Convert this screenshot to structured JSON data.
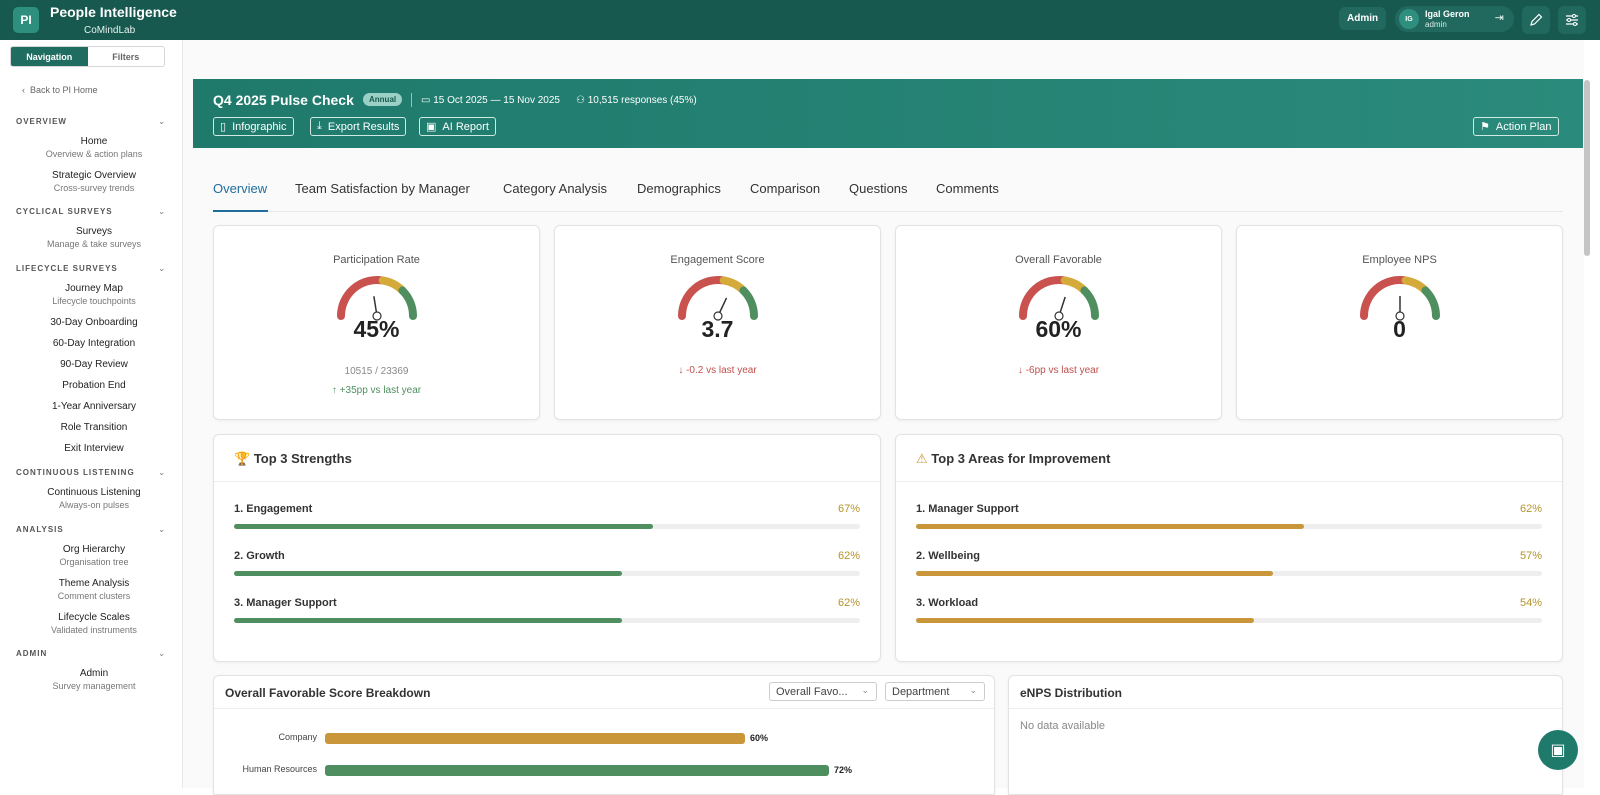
{
  "app": {
    "logo": "PI",
    "title": "People Intelligence",
    "org": "CoMindLab"
  },
  "topbar": {
    "admin_label": "Admin",
    "user_initials": "IG",
    "user_name": "Igal Geron",
    "user_role": "admin"
  },
  "sidebar": {
    "tabs": [
      "Navigation",
      "Filters"
    ],
    "back": "Back to PI Home",
    "sections": [
      {
        "title": "OVERVIEW",
        "items": [
          {
            "title": "Home",
            "sub": "Overview & action plans"
          },
          {
            "title": "Strategic Overview",
            "sub": "Cross-survey trends"
          }
        ]
      },
      {
        "title": "CYCLICAL SURVEYS",
        "items": [
          {
            "title": "Surveys",
            "sub": "Manage & take surveys"
          }
        ]
      },
      {
        "title": "LIFECYCLE SURVEYS",
        "items": [
          {
            "title": "Journey Map",
            "sub": "Lifecycle touchpoints"
          },
          {
            "title": "30-Day Onboarding",
            "sub": ""
          },
          {
            "title": "60-Day Integration",
            "sub": ""
          },
          {
            "title": "90-Day Review",
            "sub": ""
          },
          {
            "title": "Probation End",
            "sub": ""
          },
          {
            "title": "1-Year Anniversary",
            "sub": ""
          },
          {
            "title": "Role Transition",
            "sub": ""
          },
          {
            "title": "Exit Interview",
            "sub": ""
          }
        ]
      },
      {
        "title": "CONTINUOUS LISTENING",
        "items": [
          {
            "title": "Continuous Listening",
            "sub": "Always-on pulses"
          }
        ]
      },
      {
        "title": "ANALYSIS",
        "items": [
          {
            "title": "Org Hierarchy",
            "sub": "Organisation tree"
          },
          {
            "title": "Theme Analysis",
            "sub": "Comment clusters"
          },
          {
            "title": "Lifecycle Scales",
            "sub": "Validated instruments"
          }
        ]
      },
      {
        "title": "ADMIN",
        "items": [
          {
            "title": "Admin",
            "sub": "Survey management"
          }
        ]
      }
    ]
  },
  "survey": {
    "title": "Q4 2025 Pulse Check",
    "badge": "Annual",
    "dates": "15 Oct 2025 — 15 Nov 2025",
    "responses": "10,515 responses (45%)",
    "buttons": {
      "infographic": "Infographic",
      "export": "Export Results",
      "ai_report": "AI Report",
      "action_plan": "Action Plan"
    }
  },
  "tabs": [
    "Overview",
    "Team Satisfaction by Manager",
    "Category Analysis",
    "Demographics",
    "Comparison",
    "Questions",
    "Comments"
  ],
  "kpis": [
    {
      "title": "Participation Rate",
      "value": "45%",
      "level": 0.45,
      "detail": "10515 / 23369",
      "delta": "+35pp vs last year",
      "delta_dir": "up"
    },
    {
      "title": "Engagement Score",
      "value": "3.7",
      "level": 0.64,
      "detail": "",
      "delta": "-0.2 vs last year",
      "delta_dir": "down"
    },
    {
      "title": "Overall Favorable",
      "value": "60%",
      "level": 0.6,
      "detail": "",
      "delta": "-6pp vs last year",
      "delta_dir": "down"
    },
    {
      "title": "Employee NPS",
      "value": "0",
      "level": 0.5,
      "detail": "",
      "delta": "",
      "delta_dir": ""
    }
  ],
  "strengths": {
    "title": "Top 3 Strengths",
    "items": [
      {
        "label": "1. Engagement",
        "pct": "67%",
        "value": 67
      },
      {
        "label": "2. Growth",
        "pct": "62%",
        "value": 62
      },
      {
        "label": "3. Manager Support",
        "pct": "62%",
        "value": 62
      }
    ]
  },
  "improvements": {
    "title": "Top 3 Areas for Improvement",
    "items": [
      {
        "label": "1. Manager Support",
        "pct": "62%",
        "value": 62
      },
      {
        "label": "2. Wellbeing",
        "pct": "57%",
        "value": 57
      },
      {
        "label": "3. Workload",
        "pct": "54%",
        "value": 54
      }
    ]
  },
  "breakdown": {
    "title": "Overall Favorable Score Breakdown",
    "metric_select": "Overall Favo...",
    "group_select": "Department"
  },
  "enps": {
    "title": "eNPS Distribution",
    "empty": "No data available"
  },
  "chart_data": {
    "type": "bar",
    "orientation": "horizontal",
    "categories": [
      "Company",
      "Human Resources"
    ],
    "values": [
      60,
      72
    ],
    "labels": [
      "60%",
      "72%"
    ],
    "xlim": [
      0,
      100
    ]
  },
  "colors": {
    "brand": "#1f7a6c",
    "strength_bar": "#4f8f5f",
    "improvement_bar": "#c9973a",
    "up": "#4f8f5f",
    "down": "#c0504d",
    "link": "#1f6d9b"
  }
}
